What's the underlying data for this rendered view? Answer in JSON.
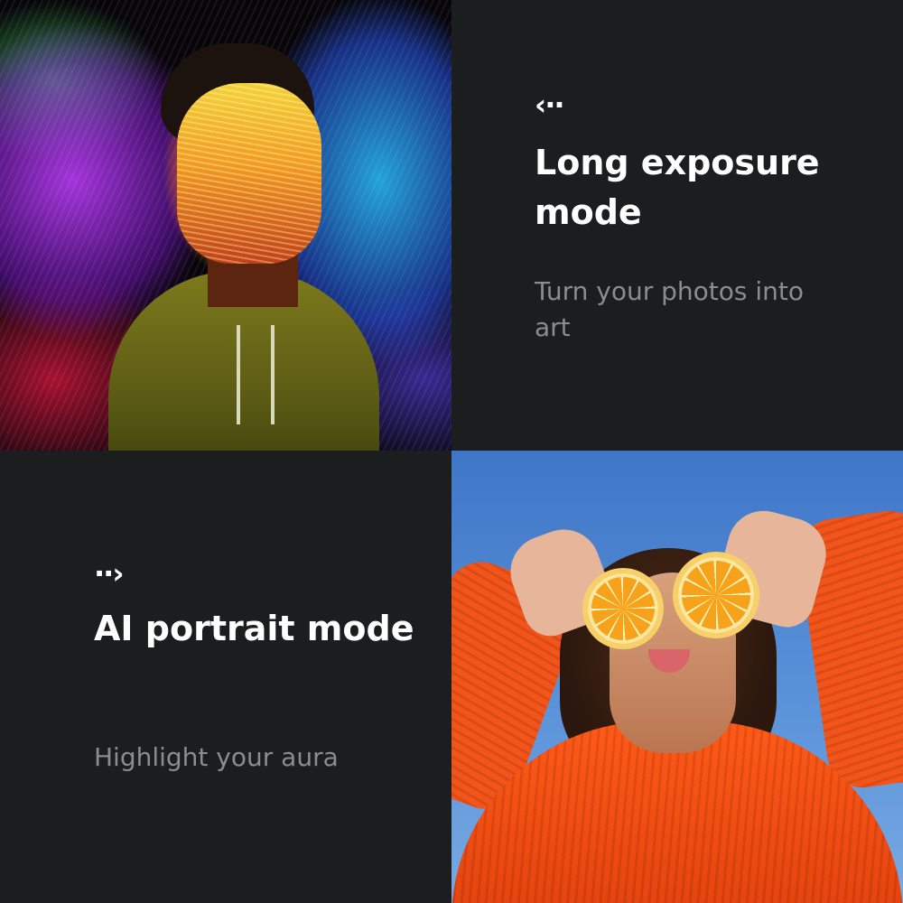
{
  "tiles": {
    "long_exposure": {
      "icon": "arrow-left-dots-icon",
      "icon_glyph": "‹··",
      "title": "Long exposure mode",
      "subtitle": "Turn your photos into art"
    },
    "ai_portrait": {
      "icon": "arrow-right-dots-icon",
      "icon_glyph": "··›",
      "title": "AI portrait mode",
      "subtitle": "Highlight your aura"
    }
  },
  "colors": {
    "panel_bg": "#1c1d1f",
    "title": "#ffffff",
    "subtitle": "#8b8c8e"
  }
}
